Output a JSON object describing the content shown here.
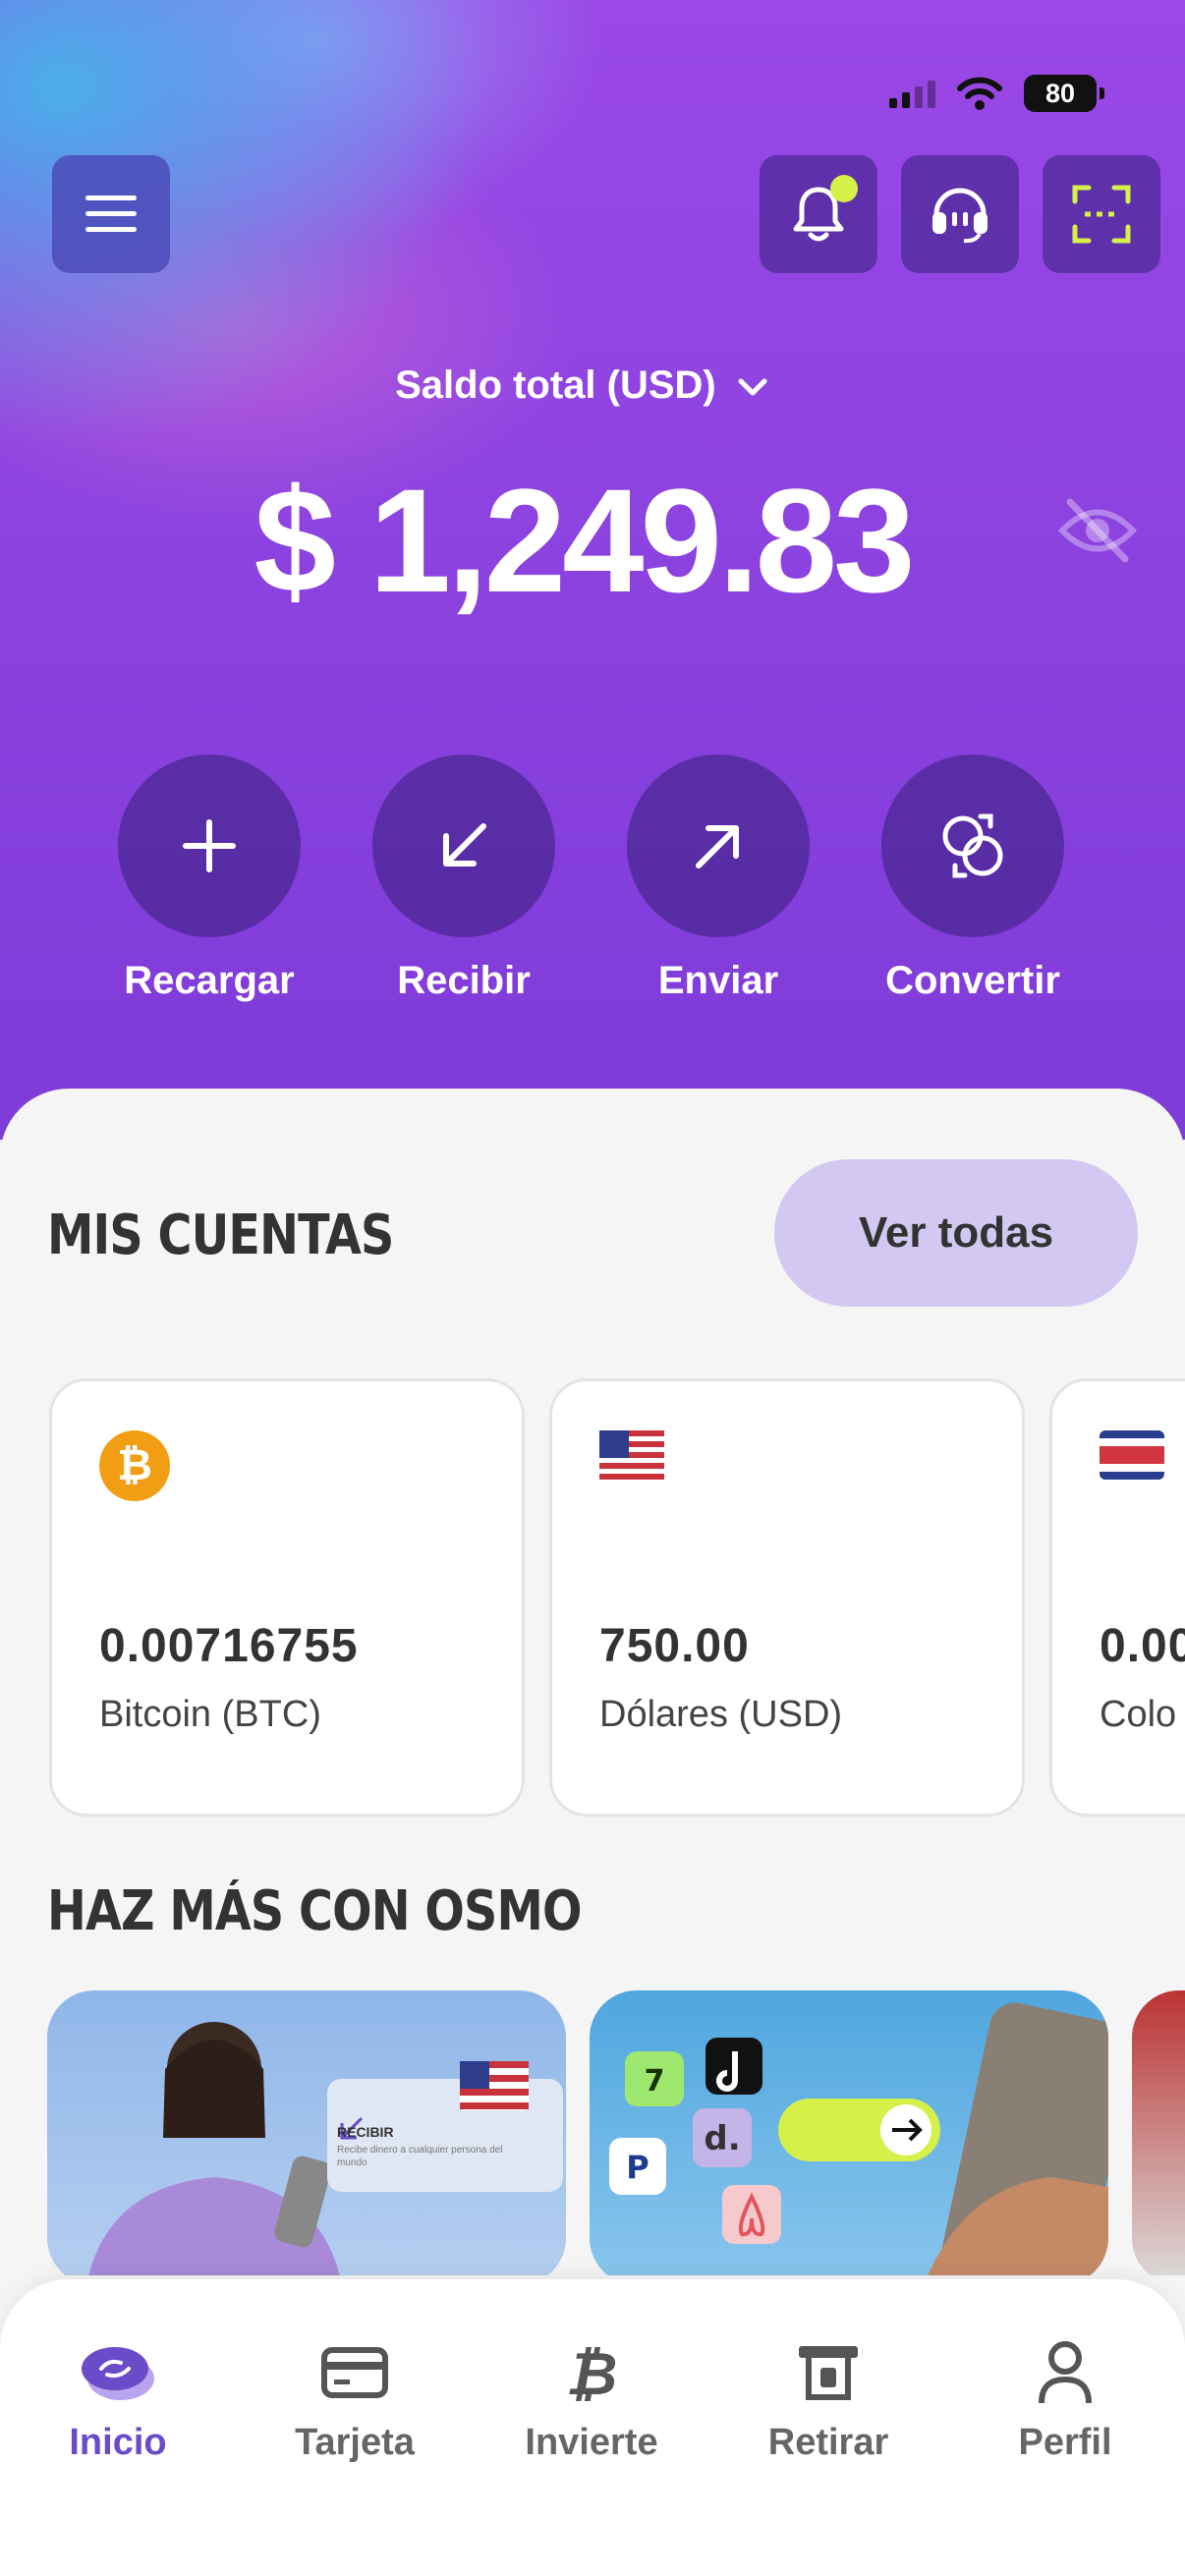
{
  "status_bar": {
    "battery": "80"
  },
  "header": {
    "balance_label": "Saldo total (USD)",
    "balance_amount": "$ 1,249.83"
  },
  "actions": [
    {
      "label": "Recargar",
      "icon": "plus-icon"
    },
    {
      "label": "Recibir",
      "icon": "arrow-down-left-icon"
    },
    {
      "label": "Enviar",
      "icon": "arrow-up-right-icon"
    },
    {
      "label": "Convertir",
      "icon": "convert-icon"
    }
  ],
  "accounts_section": {
    "title": "MIS CUENTAS",
    "view_all": "Ver todas",
    "accounts": [
      {
        "amount": "0.00716755",
        "name": "Bitcoin (BTC)",
        "icon": "bitcoin-icon"
      },
      {
        "amount": "750.00",
        "name": "Dólares (USD)",
        "icon": "us-flag-icon"
      },
      {
        "amount": "0.00",
        "name": "Colo",
        "icon": "costa-rica-flag-icon"
      }
    ]
  },
  "promo_section": {
    "title": "HAZ MÁS CON OSMO",
    "promo1_label": "RECIBIR",
    "promo1_sub": "Recibe dinero a cualquier persona del mundo"
  },
  "bottom_nav": [
    {
      "label": "Inicio",
      "icon": "home-coins-icon",
      "active": true
    },
    {
      "label": "Tarjeta",
      "icon": "card-icon"
    },
    {
      "label": "Invierte",
      "icon": "bitcoin-b-icon"
    },
    {
      "label": "Retirar",
      "icon": "atm-icon"
    },
    {
      "label": "Perfil",
      "icon": "profile-icon"
    }
  ],
  "colors": {
    "accent": "#6b4bc7",
    "hero_purple": "#8d43e0",
    "notif_dot": "#d6f04a",
    "bitcoin": "#f29e14"
  }
}
